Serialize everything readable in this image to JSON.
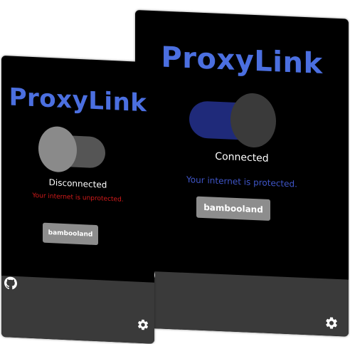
{
  "back_card": {
    "brand": "ProxyLink",
    "status_label": "Connected",
    "status_message": "Your internet is protected.",
    "user_button": "bambooland",
    "toggle_state": "on",
    "icons": {
      "footer_left": "github-icon",
      "footer_right": "gear-icon"
    },
    "colors": {
      "brand": "#4b6fe0",
      "message": "#3f55c7",
      "track": "#1f2a7a"
    }
  },
  "front_card": {
    "brand": "ProxyLink",
    "status_label": "Disconnected",
    "status_message": "Your internet is unprotected.",
    "user_button": "bambooland",
    "toggle_state": "off",
    "icons": {
      "footer_left": "github-icon",
      "footer_right": "gear-icon"
    },
    "colors": {
      "brand": "#4b6fe0",
      "message": "#d11a1a",
      "track": "#555555"
    }
  }
}
